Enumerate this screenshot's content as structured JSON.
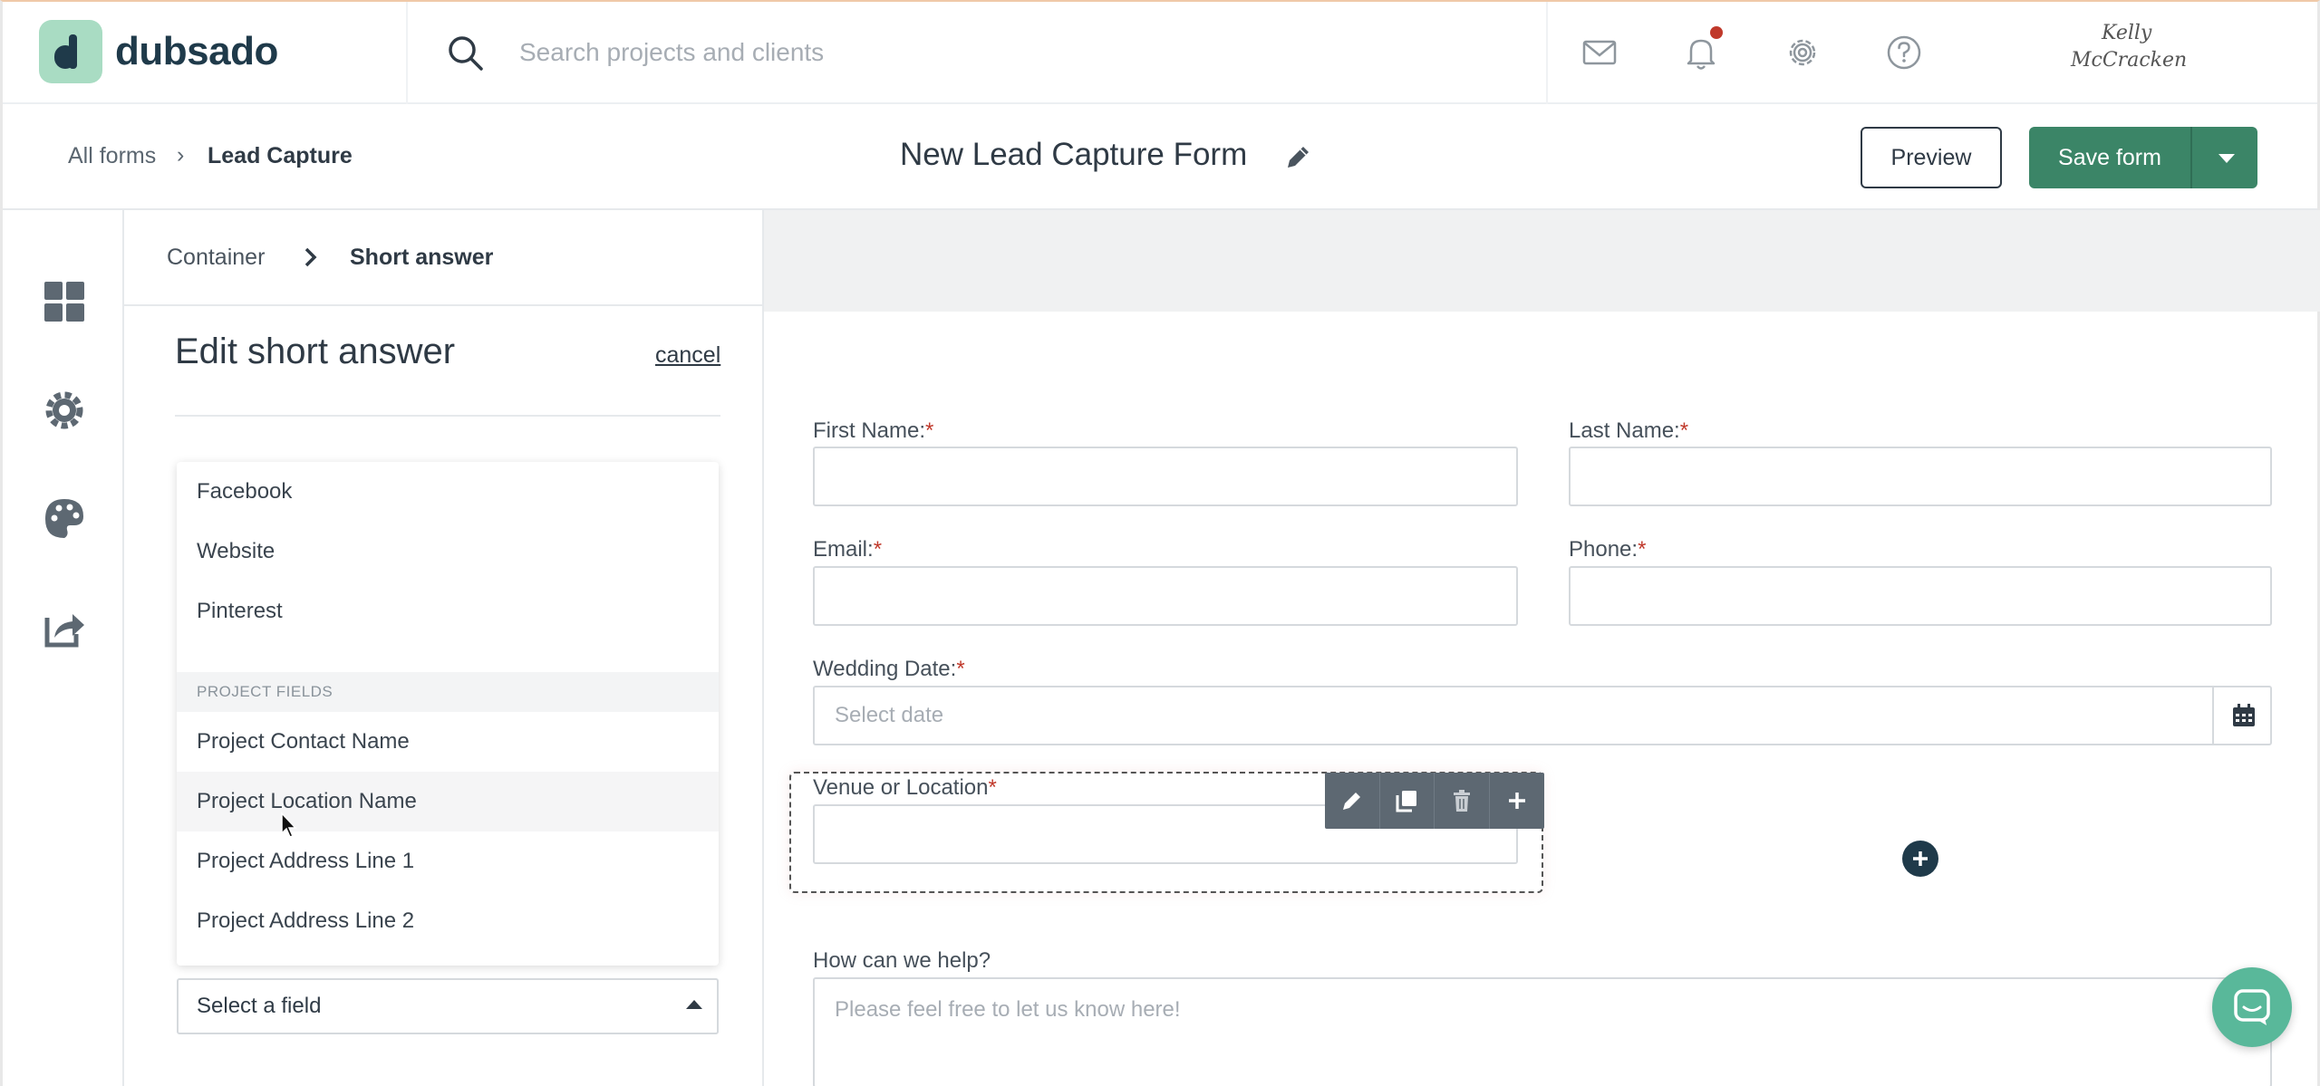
{
  "app": {
    "brand": "dubsado"
  },
  "topbar": {
    "search_placeholder": "Search projects and clients",
    "signature_line1": "Kelly",
    "signature_line2": "McCracken"
  },
  "formbar": {
    "crumb_all": "All forms",
    "crumb_sep": "›",
    "crumb_current": "Lead Capture",
    "title": "New Lead Capture Form",
    "preview_label": "Preview",
    "save_label": "Save form"
  },
  "panel": {
    "crumb_container": "Container",
    "crumb_current": "Short answer",
    "title": "Edit short answer",
    "cancel_label": "cancel",
    "dropdown": {
      "items_top": [
        "Facebook",
        "Website",
        "Pinterest"
      ],
      "group_label": "PROJECT FIELDS",
      "items_project": [
        "Project Contact Name",
        "Project Location Name",
        "Project Address Line 1",
        "Project Address Line 2"
      ]
    },
    "select_placeholder": "Select a field"
  },
  "form": {
    "first_name_label": "First Name:",
    "last_name_label": "Last Name:",
    "email_label": "Email:",
    "phone_label": "Phone:",
    "wedding_date_label": "Wedding Date:",
    "wedding_date_placeholder": "Select date",
    "venue_label": "Venue or Location",
    "help_label": "How can we help?",
    "help_placeholder": "Please feel free to let us know here!",
    "required_mark": "*"
  },
  "colors": {
    "brand_green": "#3b8567",
    "logo_mint": "#a9dcc3",
    "dark_navy": "#1f3a4a",
    "required_red": "#c0392b",
    "chat_green": "#59b89a"
  }
}
